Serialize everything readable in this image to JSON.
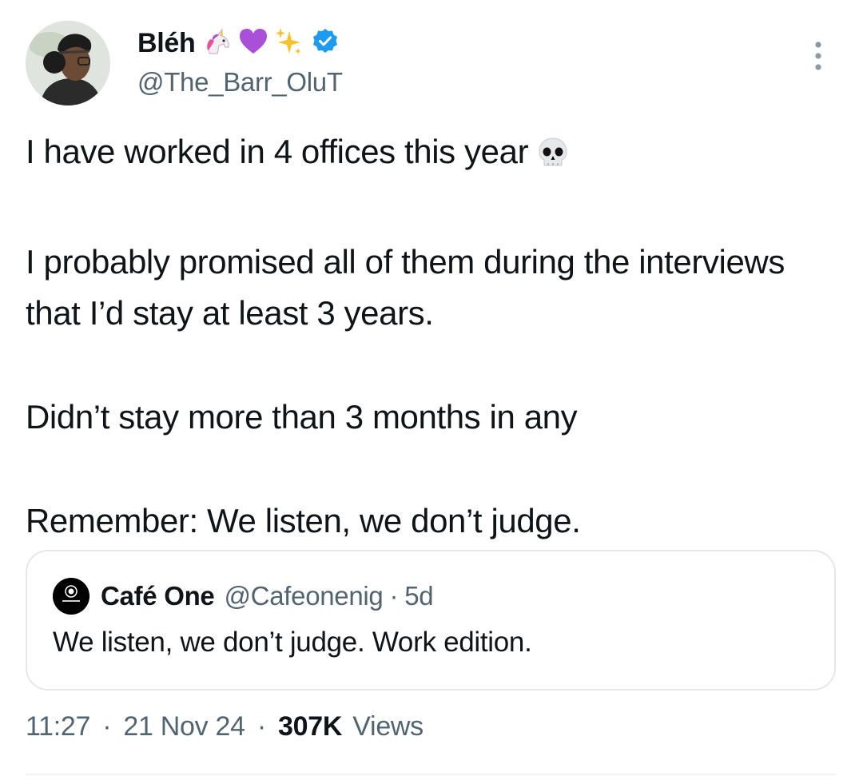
{
  "author": {
    "display_name": "Bléh",
    "handle": "@The_Barr_OluT",
    "verified": true,
    "name_emojis": [
      "unicorn-icon",
      "purple-heart-icon",
      "sparkles-icon"
    ]
  },
  "tweet": {
    "paragraphs": [
      "I have worked in 4 offices this year",
      "I probably promised all of them during the interviews that I’d stay at least 3 years.",
      "Didn’t stay more than 3 months in any",
      "Remember: We listen, we don’t judge."
    ],
    "trailing_emoji": "skull-icon"
  },
  "quote": {
    "display_name": "Café One",
    "handle": "@Cafeonenig",
    "separator": "·",
    "age": "5d",
    "text": "We listen, we don’t judge. Work edition."
  },
  "meta": {
    "time": "11:27",
    "date": "21 Nov 24",
    "views_count": "307K",
    "views_label": "Views",
    "separator": "·"
  },
  "colors": {
    "text": "#0f1419",
    "secondary": "#536471",
    "verified": "#1d9bf0",
    "border": "#e4e8ea"
  }
}
